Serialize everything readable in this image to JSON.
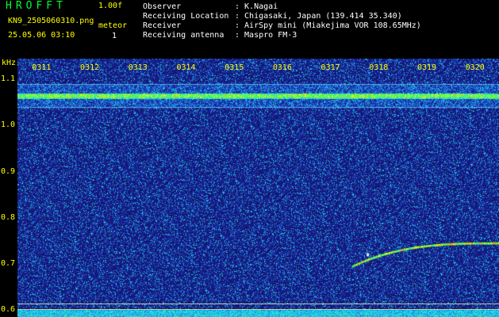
{
  "header": {
    "app_title": "HROFFT",
    "version": "1.00f",
    "filename": "KN9_2505060310.png",
    "datetime": "25.05.06 03:10",
    "meteor_label": "meteor",
    "meteor_count": "1",
    "info": [
      {
        "label": "Observer",
        "value": ": K.Nagai"
      },
      {
        "label": "Receiving Location",
        "value": ": Chigasaki, Japan (139.414 35.340)"
      },
      {
        "label": "Receiver",
        "value": ": AirSpy mini (Miakejima VOR 108.65MHz)"
      },
      {
        "label": "Receiving antenna",
        "value": ": Maspro FM-3"
      }
    ]
  },
  "plot": {
    "y_unit": "kHz",
    "y_ticks": [
      "1.1",
      "1.0",
      "0.9",
      "0.8",
      "0.7",
      "0.6"
    ],
    "y_range": [
      0.585,
      1.145
    ],
    "x_ticks": [
      "0311",
      "0312",
      "0313",
      "0314",
      "0315",
      "0316",
      "0317",
      "0318",
      "0319",
      "0320"
    ],
    "x_range_minutes": [
      10.5,
      20.5
    ],
    "carrier_khz": 1.065,
    "carrier_band_khz": [
      1.04,
      1.09
    ],
    "meteor_trace": {
      "start_min": 17.45,
      "start_khz": 0.695,
      "end_min": 20.5,
      "end_khz": 0.745
    },
    "reference_lines_khz": [
      0.615,
      0.603
    ],
    "colors": {
      "background": "#1a1a80",
      "carrier": "#00ff66",
      "label": "#ffff00"
    }
  }
}
